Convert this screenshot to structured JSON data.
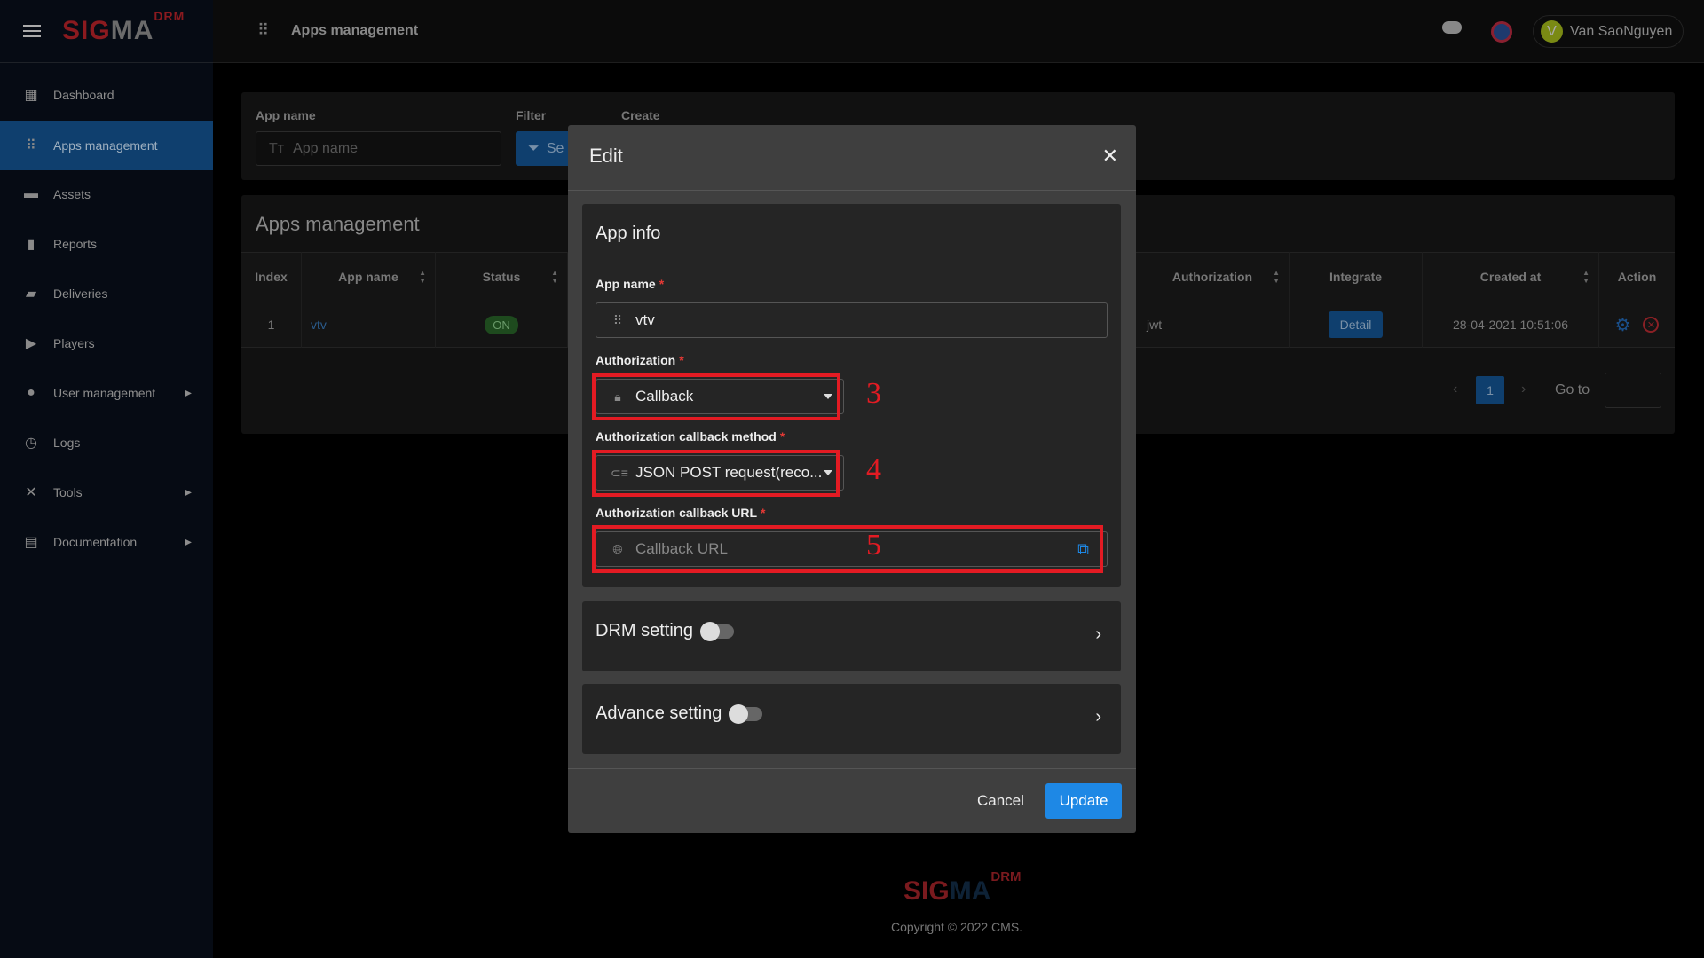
{
  "brand": {
    "logo_a": "SI",
    "logo_b": "G",
    "logo_c": "MA",
    "logo_sup": "DRM"
  },
  "header": {
    "title": "Apps management",
    "user_initial": "V",
    "user_name": "Van SaoNguyen"
  },
  "sidebar": {
    "items": [
      {
        "label": "Dashboard",
        "icon": "dashboard-icon"
      },
      {
        "label": "Apps management",
        "icon": "apps-icon",
        "active": true
      },
      {
        "label": "Assets",
        "icon": "briefcase-icon"
      },
      {
        "label": "Reports",
        "icon": "bar-chart-icon"
      },
      {
        "label": "Deliveries",
        "icon": "truck-icon"
      },
      {
        "label": "Players",
        "icon": "play-icon"
      },
      {
        "label": "User management",
        "icon": "user-icon",
        "submenu": true
      },
      {
        "label": "Logs",
        "icon": "history-icon"
      },
      {
        "label": "Tools",
        "icon": "tools-icon",
        "submenu": true
      },
      {
        "label": "Documentation",
        "icon": "book-icon",
        "submenu": true
      }
    ]
  },
  "filter": {
    "app_name_label": "App name",
    "app_name_placeholder": "App name",
    "filter_label": "Filter",
    "filter_button": "Se",
    "create_label": "Create"
  },
  "table": {
    "title": "Apps management",
    "headers": {
      "index": "Index",
      "app_name": "App name",
      "status": "Status",
      "authorization": "Authorization",
      "integrate": "Integrate",
      "created_at": "Created at",
      "action": "Action"
    },
    "rows": [
      {
        "index": "1",
        "app_name": "vtv",
        "status": "ON",
        "authorization": "jwt",
        "integrate": "Detail",
        "created_at": "28-04-2021 10:51:06"
      }
    ],
    "pagination": {
      "current": "1",
      "goto_label": "Go to"
    }
  },
  "modal": {
    "title": "Edit",
    "section_title": "App info",
    "app_name_label": "App name",
    "app_name_value": "vtv",
    "authorization_label": "Authorization",
    "authorization_value": "Callback",
    "method_label": "Authorization callback method",
    "method_value": "JSON POST request(reco...",
    "url_label": "Authorization callback URL",
    "url_placeholder": "Callback URL",
    "drm_setting": "DRM setting",
    "drm_enabled": false,
    "advance_setting": "Advance setting",
    "advance_enabled": false,
    "cancel": "Cancel",
    "update": "Update",
    "annotations": [
      "3",
      "4",
      "5"
    ]
  },
  "footer": {
    "copyright": "Copyright © 2022 CMS."
  },
  "colors": {
    "accent": "#1e88e5",
    "annotation": "#e31b23",
    "sidebar_active": "#0f3f6e"
  }
}
